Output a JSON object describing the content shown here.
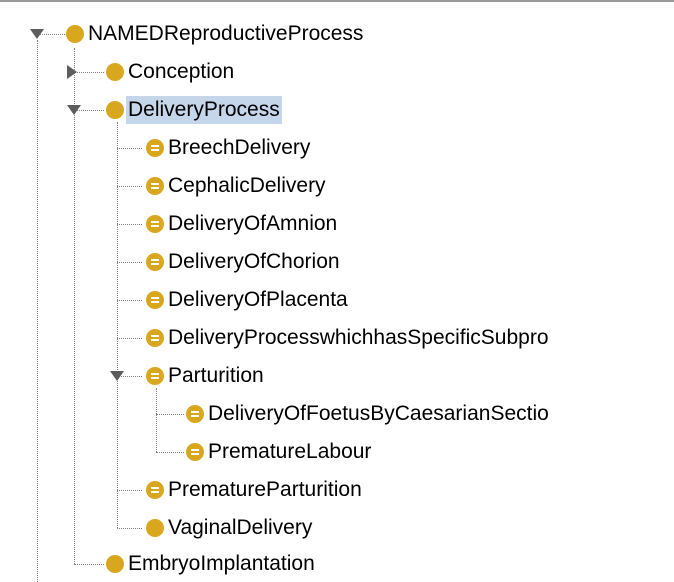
{
  "tree": {
    "items": [
      {
        "label": "NAMEDReproductiveProcess",
        "icon": "class-dot-icon",
        "toggle": "expanded"
      },
      {
        "label": "Conception",
        "icon": "class-dot-icon",
        "toggle": "collapsed"
      },
      {
        "label": "DeliveryProcess",
        "icon": "class-dot-icon",
        "toggle": "expanded",
        "selected": true
      },
      {
        "label": "BreechDelivery",
        "icon": "defined-class-icon"
      },
      {
        "label": "CephalicDelivery",
        "icon": "defined-class-icon"
      },
      {
        "label": "DeliveryOfAmnion",
        "icon": "defined-class-icon"
      },
      {
        "label": "DeliveryOfChorion",
        "icon": "defined-class-icon"
      },
      {
        "label": "DeliveryOfPlacenta",
        "icon": "defined-class-icon"
      },
      {
        "label": "DeliveryProcesswhichhasSpecificSubpro",
        "icon": "defined-class-icon"
      },
      {
        "label": "Parturition",
        "icon": "defined-class-icon",
        "toggle": "expanded"
      },
      {
        "label": "DeliveryOfFoetusByCaesarianSectio",
        "icon": "defined-class-icon"
      },
      {
        "label": "PrematureLabour",
        "icon": "defined-class-icon"
      },
      {
        "label": "PrematureParturition",
        "icon": "defined-class-icon"
      },
      {
        "label": "VaginalDelivery",
        "icon": "class-dot-icon"
      },
      {
        "label": "EmbryoImplantation",
        "icon": "class-dot-icon"
      }
    ]
  },
  "colors": {
    "class_icon": "#d8a71e",
    "selection": "#c5d5ea",
    "connector": "#808080"
  }
}
